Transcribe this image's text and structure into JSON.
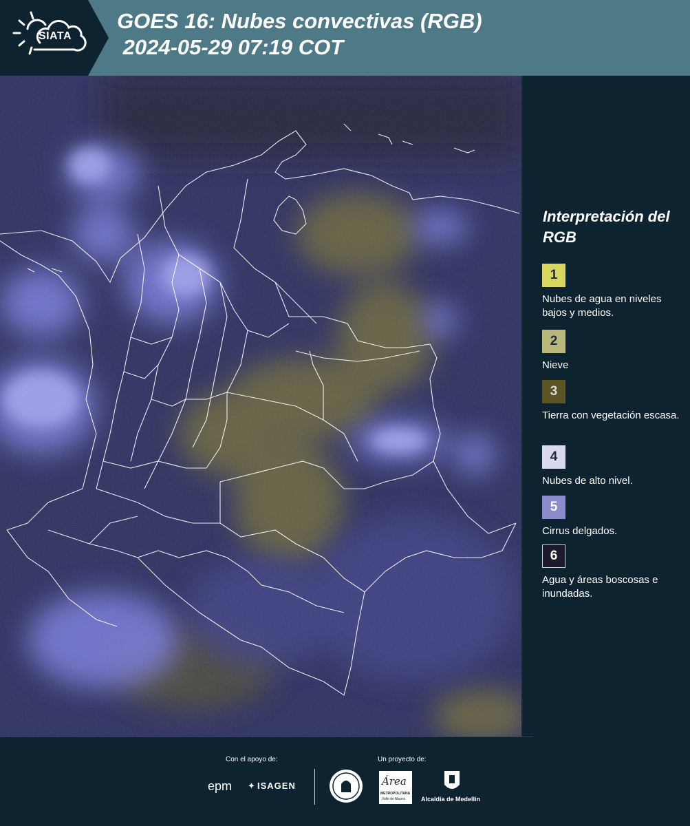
{
  "header": {
    "logo_text": "SIATA",
    "title": "GOES 16: Nubes convectivas (RGB)\n 2024-05-29 07:19 COT"
  },
  "map": {
    "product": "GOES 16 RGB satellite composite",
    "dominant_colors": [
      "#3b3e8a",
      "#7c7ed8",
      "#6e6a3e",
      "#1c1f3a"
    ]
  },
  "legend": {
    "title": "Interpretación del RGB",
    "items": [
      {
        "number": "1",
        "label": "Nubes de agua en niveles bajos y medios.",
        "color": "#d9d760"
      },
      {
        "number": "2",
        "label": "Nieve",
        "color": "#b9b779"
      },
      {
        "number": "3",
        "label": "Tierra con vegetación escasa.",
        "color": "#5a5522"
      },
      {
        "number": "4",
        "label": "Nubes de alto nivel.",
        "color": "#d9d9f3"
      },
      {
        "number": "5",
        "label": "Cirrus delgados.",
        "color": "#8c8ccd"
      },
      {
        "number": "6",
        "label": "Agua y áreas boscosas e inundadas.",
        "color": "#1d1a2b"
      }
    ]
  },
  "footer": {
    "support_caption": "Con el apoyo de:",
    "project_caption": "Un proyecto de:",
    "epm": "epm",
    "isagen": "ISAGEN",
    "area_main": "Área",
    "area_sub": "METROPOLITANA",
    "area_sub2": "Valle de Aburrá",
    "medellin": "Alcaldía de Medellín"
  }
}
